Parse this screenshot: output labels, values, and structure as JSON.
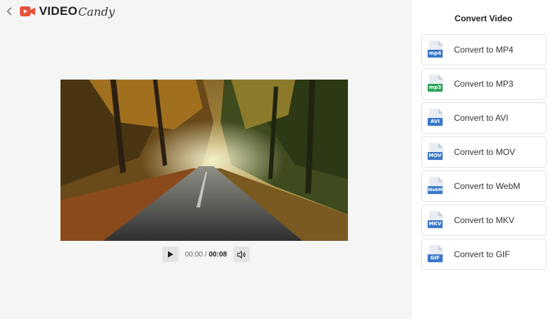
{
  "header": {
    "back_label": "‹",
    "logo_video": "VIDEO",
    "logo_candy": "Candy",
    "logo_icon": "video-camera-icon",
    "brand_color": "#e8503a"
  },
  "player": {
    "current_time": "00:00",
    "separator": "/",
    "duration": "00:08",
    "play_icon": "play-icon",
    "volume_icon": "volume-icon"
  },
  "panel": {
    "title": "Convert Video",
    "options": [
      {
        "label": "Convert to MP4",
        "tag": "mp4",
        "color": "#3a78c8"
      },
      {
        "label": "Convert to MP3",
        "tag": "mp3",
        "color": "#2ea45c"
      },
      {
        "label": "Convert to AVI",
        "tag": "AVI",
        "color": "#3a78c8"
      },
      {
        "label": "Convert to MOV",
        "tag": "MOV",
        "color": "#3a78c8"
      },
      {
        "label": "Convert to WebM",
        "tag": "WebM",
        "color": "#3a78c8"
      },
      {
        "label": "Convert to MKV",
        "tag": "MKV",
        "color": "#3a78c8"
      },
      {
        "label": "Convert to GIF",
        "tag": "GIF",
        "color": "#3a78c8"
      }
    ]
  }
}
